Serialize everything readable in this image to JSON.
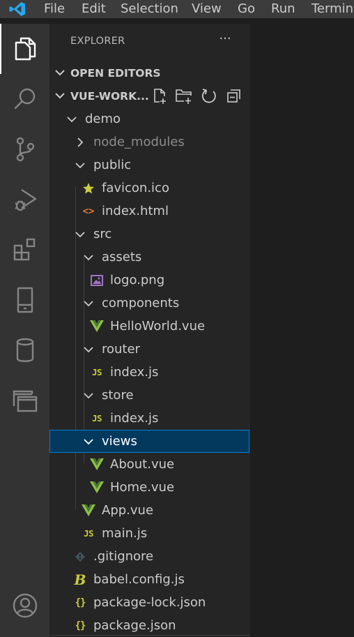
{
  "menu": {
    "items": [
      "File",
      "Edit",
      "Selection",
      "View",
      "Go",
      "Run",
      "Terminal"
    ]
  },
  "activity_bar": {
    "icons": [
      "explorer-icon",
      "search-icon",
      "source-control-icon",
      "run-debug-icon",
      "extensions-icon",
      "remote-explorer-icon",
      "database-icon",
      "remote-window-icon",
      "account-icon"
    ]
  },
  "explorer": {
    "header": "EXPLORER",
    "more_actions": "···",
    "open_editors": "OPEN EDITORS",
    "workspace": "VUE-WORK...",
    "tree": [
      {
        "label": "demo",
        "type": "folder",
        "expanded": true
      },
      {
        "label": "node_modules",
        "type": "folder",
        "expanded": false
      },
      {
        "label": "public",
        "type": "folder",
        "expanded": true
      },
      {
        "label": "favicon.ico",
        "type": "file",
        "icon": "star-icon"
      },
      {
        "label": "index.html",
        "type": "file",
        "icon": "html-icon"
      },
      {
        "label": "src",
        "type": "folder",
        "expanded": true
      },
      {
        "label": "assets",
        "type": "folder",
        "expanded": true
      },
      {
        "label": "logo.png",
        "type": "file",
        "icon": "image-icon"
      },
      {
        "label": "components",
        "type": "folder",
        "expanded": true
      },
      {
        "label": "HelloWorld.vue",
        "type": "file",
        "icon": "vue-icon"
      },
      {
        "label": "router",
        "type": "folder",
        "expanded": true
      },
      {
        "label": "index.js",
        "type": "file",
        "icon": "js-icon"
      },
      {
        "label": "store",
        "type": "folder",
        "expanded": true
      },
      {
        "label": "index.js",
        "type": "file",
        "icon": "js-icon"
      },
      {
        "label": "views",
        "type": "folder",
        "expanded": true,
        "selected": true
      },
      {
        "label": "About.vue",
        "type": "file",
        "icon": "vue-icon"
      },
      {
        "label": "Home.vue",
        "type": "file",
        "icon": "vue-icon"
      },
      {
        "label": "App.vue",
        "type": "file",
        "icon": "vue-icon"
      },
      {
        "label": "main.js",
        "type": "file",
        "icon": "js-icon"
      },
      {
        "label": ".gitignore",
        "type": "file",
        "icon": "git-icon"
      },
      {
        "label": "babel.config.js",
        "type": "file",
        "icon": "babel-icon"
      },
      {
        "label": "package-lock.json",
        "type": "file",
        "icon": "json-icon"
      },
      {
        "label": "package.json",
        "type": "file",
        "icon": "json-icon"
      }
    ],
    "badges": {
      "js": "JS",
      "json": "{}",
      "html": "<>",
      "babel": "B"
    }
  },
  "colors": {
    "accent": "#007acc",
    "vscode_logo": "#23a9f2",
    "vue_green": "#8dc149",
    "js_yellow": "#cbcb41",
    "html_orange": "#e37933",
    "image_purple": "#a074c4",
    "selection_bg": "#04395e",
    "selection_border": "#007fd4"
  }
}
